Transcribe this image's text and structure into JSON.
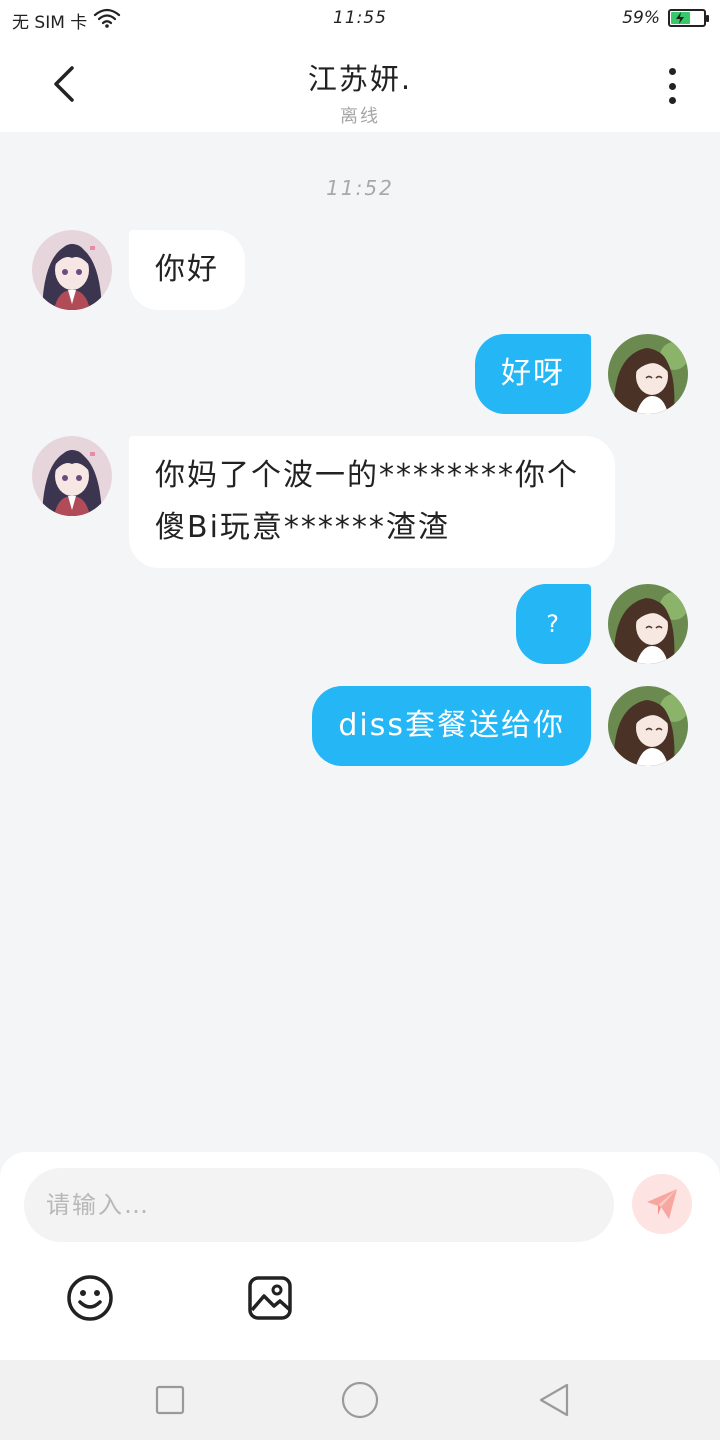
{
  "status_bar": {
    "carrier": "无 SIM 卡",
    "time": "11:55",
    "battery": "59%",
    "battery_level": 0.59
  },
  "header": {
    "title": "江苏妍.",
    "subtitle": "离线"
  },
  "chat": {
    "timestamp": "11:52",
    "messages": [
      {
        "side": "left",
        "text": "你好"
      },
      {
        "side": "right",
        "text": "好呀"
      },
      {
        "side": "left",
        "text": "你妈了个波一的********你个傻Bi玩意******渣渣"
      },
      {
        "side": "right",
        "text": "?"
      },
      {
        "side": "right",
        "text": "diss套餐送给你"
      }
    ]
  },
  "input": {
    "placeholder": "请输入…",
    "value": ""
  },
  "icons": {
    "back": "chevron-left-icon",
    "more": "more-vertical-icon",
    "send": "paper-plane-icon",
    "emoji": "smiley-icon",
    "image": "image-icon",
    "nav_recent": "square-icon",
    "nav_home": "circle-icon",
    "nav_back": "triangle-back-icon"
  },
  "colors": {
    "outgoing_bubble": "#25b6f5",
    "incoming_bubble": "#ffffff",
    "background": "#f4f5f7",
    "send_button": "#fde3e1",
    "send_icon": "#f7a7a0",
    "battery_fill": "#36c96a"
  }
}
